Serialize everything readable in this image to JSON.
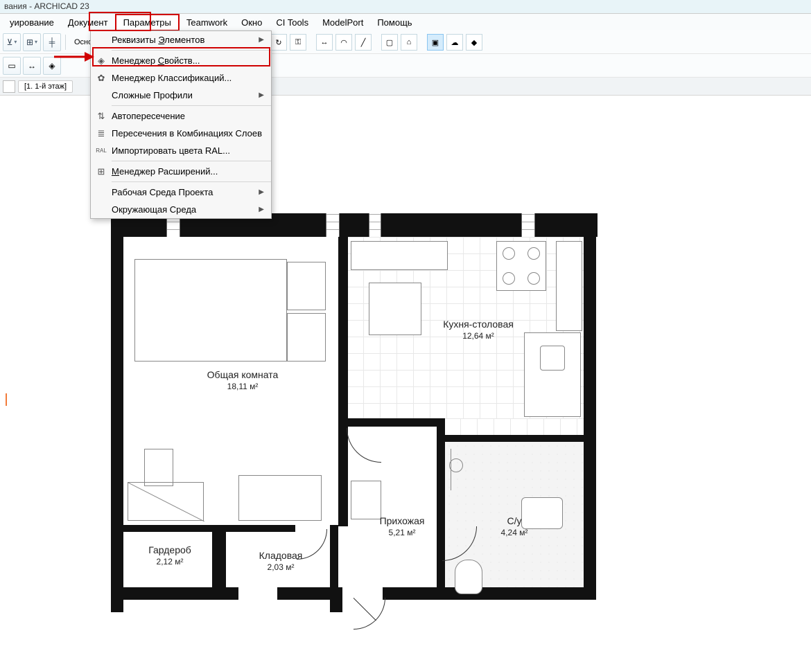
{
  "title": "вания - ARCHICAD 23",
  "menubar": [
    "уирование",
    "Документ",
    "Параметры",
    "Teamwork",
    "Окно",
    "CI Tools",
    "ModelPort",
    "Помощь"
  ],
  "active_menu_index": 2,
  "dropdown": {
    "items": [
      {
        "icon": "",
        "label": "Реквизиты Элементов",
        "ul": "Э",
        "sub": true
      },
      {
        "divider": true
      },
      {
        "icon": "◈",
        "label": "Менеджер Свойств...",
        "ul": "С"
      },
      {
        "icon": "⚙",
        "label": "Менеджер Классификаций...",
        "ul": ""
      },
      {
        "icon": "",
        "label": "Сложные Профили",
        "ul": "",
        "sub": true
      },
      {
        "divider": true
      },
      {
        "icon": "⇵",
        "label": "Автопересечение"
      },
      {
        "icon": "≡",
        "label": "Пересечения в Комбинациях Слоев"
      },
      {
        "icon": "RAL",
        "label": "Импортировать цвета RAL..."
      },
      {
        "divider": true
      },
      {
        "icon": "⊞",
        "label": "Менеджер Расширений...",
        "ul": "М"
      },
      {
        "divider": true
      },
      {
        "icon": "",
        "label": "Рабочая Среда Проекта",
        "sub": true
      },
      {
        "icon": "",
        "label": "Окружающая Среда",
        "sub": true
      }
    ]
  },
  "toolbar1": {
    "base_label": "Основная:"
  },
  "tabbar": {
    "tab1": "[1. 1-й этаж]"
  },
  "rooms": {
    "living": {
      "name": "Общая комната",
      "area": "18,11 м²"
    },
    "kitchen": {
      "name": "Кухня-столовая",
      "area": "12,64 м²"
    },
    "hall": {
      "name": "Прихожая",
      "area": "5,21 м²"
    },
    "bath": {
      "name": "С/у",
      "area": "4,24 м²"
    },
    "wardrobe": {
      "name": "Гардероб",
      "area": "2,12 м²"
    },
    "storage": {
      "name": "Кладовая",
      "area": "2,03 м²"
    }
  }
}
